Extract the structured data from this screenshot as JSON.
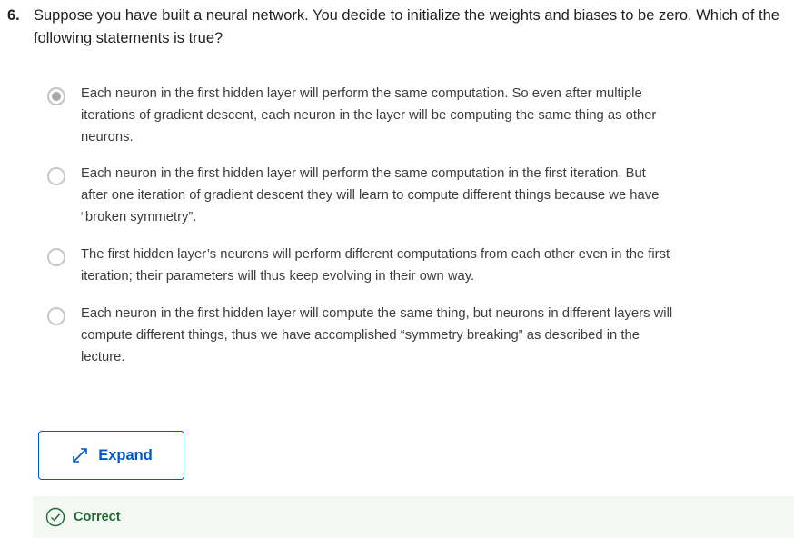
{
  "question": {
    "number": "6.",
    "text": "Suppose you have built a neural network. You decide to initialize the weights and biases to be zero. Which of the following statements is true?"
  },
  "options": [
    {
      "text": "Each neuron in the first hidden layer will perform the same computation. So even after multiple iterations of gradient descent, each neuron in the layer will be computing the same thing as other neurons.",
      "selected": true
    },
    {
      "text": "Each neuron in the first hidden layer will perform the same computation in the first iteration. But after one iteration of gradient descent they will learn to compute different things because we have “broken symmetry”.",
      "selected": false
    },
    {
      "text": "The first hidden layer’s neurons will perform different computations from each other even in the first iteration; their parameters will thus keep evolving in their own way.",
      "selected": false
    },
    {
      "text": "Each neuron in the first hidden layer will compute the same thing, but neurons in different layers will compute different things, thus we have accomplished “symmetry breaking” as described in the lecture.",
      "selected": false
    }
  ],
  "expand_button": {
    "label": "Expand",
    "icon": "expand-arrows-icon"
  },
  "result": {
    "label": "Correct",
    "icon": "check-circle-icon"
  },
  "colors": {
    "accent": "#0056d2",
    "correct": "#1d6b32",
    "correct_bg": "#f3f8f3"
  }
}
